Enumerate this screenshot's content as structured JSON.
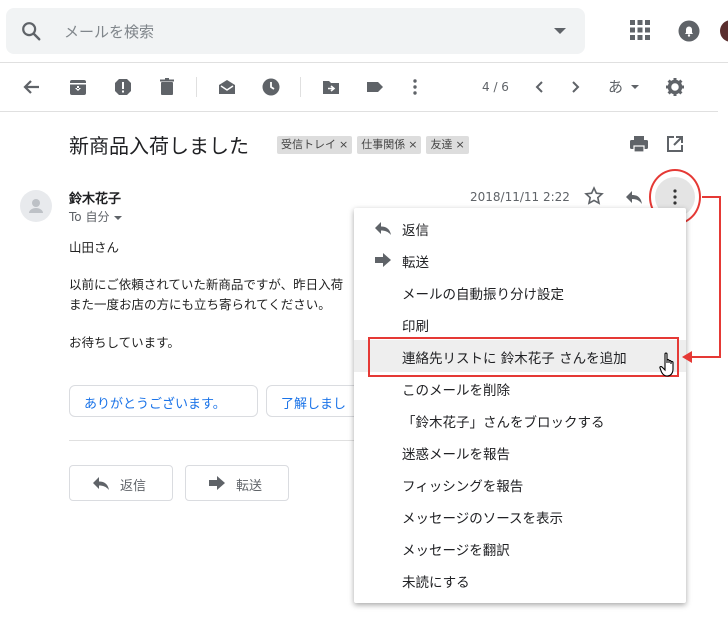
{
  "search": {
    "placeholder": "メールを検索"
  },
  "toolbar": {
    "pager": "4 / 6",
    "input_lang": "あ"
  },
  "email": {
    "subject": "新商品入荷しました",
    "labels": [
      "受信トレイ",
      "仕事関係",
      "友達"
    ],
    "label_remove": "×",
    "sender": "鈴木花子",
    "to": "To 自分",
    "date": "2018/11/11 2:22",
    "body": [
      "山田さん",
      "以前にご依頼されていた新商品ですが、昨日入荷",
      "また一度お店の方にも立ち寄られてください。",
      "お待ちしています。"
    ],
    "smart_replies": [
      "ありがとうございます。",
      "了解しまし"
    ],
    "actions": {
      "reply": "返信",
      "forward": "転送"
    }
  },
  "menu": {
    "items": [
      {
        "label": "返信",
        "icon": "reply-icon"
      },
      {
        "label": "転送",
        "icon": "forward-icon"
      },
      {
        "label": "メールの自動振り分け設定"
      },
      {
        "label": "印刷"
      },
      {
        "label": "連絡先リストに 鈴木花子 さんを追加",
        "highlighted": true
      },
      {
        "label": "このメールを削除"
      },
      {
        "label": "「鈴木花子」さんをブロックする"
      },
      {
        "label": "迷惑メールを報告"
      },
      {
        "label": "フィッシングを報告"
      },
      {
        "label": "メッセージのソースを表示"
      },
      {
        "label": "メッセージを翻訳"
      },
      {
        "label": "未読にする"
      }
    ]
  },
  "colors": {
    "annotation_red": "#e53935",
    "link_blue": "#1a73e8",
    "icon_gray": "#5f6368"
  }
}
